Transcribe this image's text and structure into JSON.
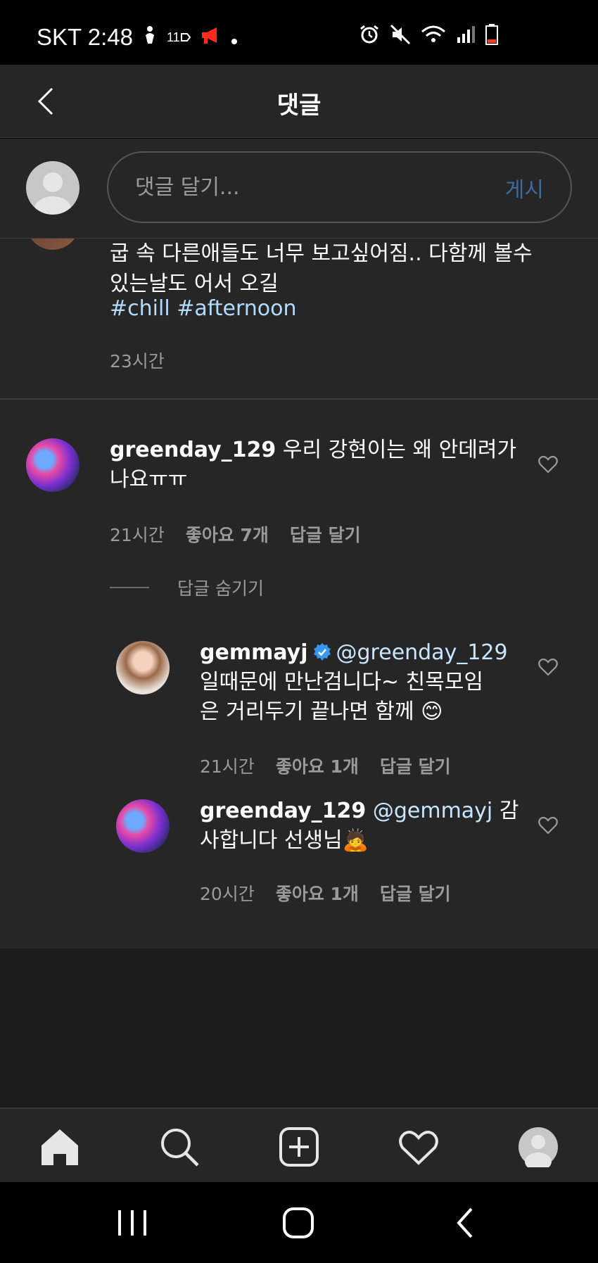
{
  "status_bar": {
    "carrier_time": "SKT 2:48",
    "network_badge": "11",
    "icons_left": [
      "person-walking-icon",
      "network-11-icon",
      "megaphone-icon",
      "dot-icon"
    ],
    "icons_right": [
      "alarm-icon",
      "mute-icon",
      "wifi-icon",
      "signal-icon",
      "battery-low-icon"
    ]
  },
  "header": {
    "title": "댓글"
  },
  "compose": {
    "placeholder": "댓글 달기...",
    "post_label": "게시"
  },
  "caption": {
    "text_line1": "굽 속 다른애들도 너무 보고싶어짐.. 다함께 볼수",
    "text_line2": "있는날도 어서 오길",
    "hashtag1": "#chill",
    "hashtag2": "#afternoon",
    "time": "23시간"
  },
  "comments": [
    {
      "username": "greenday_129",
      "text_line1": "우리 강현이는 왜 안데려가",
      "text_line2": "나요ㅠㅠ",
      "time": "21시간",
      "likes": "좋아요 7개",
      "reply_label": "답글 달기",
      "hide_replies_label": "답글 숨기기"
    }
  ],
  "replies": [
    {
      "username": "gemmayj",
      "mention": "@greenday_129",
      "text_line1": "일때문에 만난검니다~ 친목모임",
      "text_line2": "은 거리두기 끝나면 함께 😊",
      "time": "21시간",
      "likes": "좋아요 1개",
      "reply_label": "답글 달기"
    },
    {
      "username": "greenday_129",
      "mention": "@gemmayj",
      "text_line1_suffix": "감",
      "text_line2": "사합니다 선생님🙇",
      "time": "20시간",
      "likes": "좋아요 1개",
      "reply_label": "답글 달기"
    }
  ],
  "bottom_nav": [
    "home-icon",
    "search-icon",
    "add-post-icon",
    "activity-heart-icon",
    "profile-avatar-icon"
  ],
  "system_nav": [
    "recent-apps-icon",
    "home-button-icon",
    "back-icon"
  ],
  "colors": {
    "background": "#262626",
    "accent_link": "#3d6c9c",
    "hashtag": "#b3dbff",
    "muted_text": "#9a9a9a"
  }
}
